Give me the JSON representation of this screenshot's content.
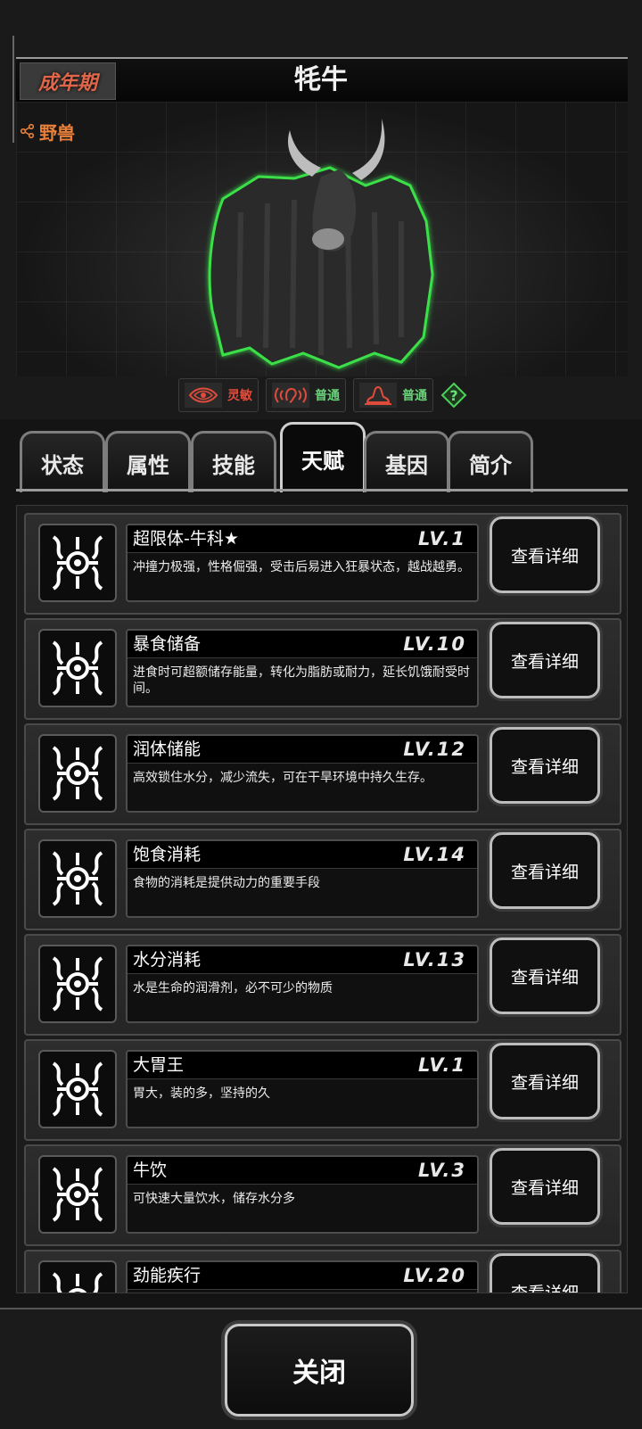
{
  "header": {
    "stage": "成年期",
    "name": "牦牛",
    "category": "野兽"
  },
  "traits": [
    {
      "icon": "eye-icon",
      "label": "灵敏",
      "color": "#e04c3c"
    },
    {
      "icon": "ear-icon",
      "label": "普通",
      "color": "#6ad27a"
    },
    {
      "icon": "smell-icon",
      "label": "普通",
      "color": "#6ad27a"
    }
  ],
  "help_icon": "question-diamond-icon",
  "tabs": [
    {
      "label": "状态",
      "active": false
    },
    {
      "label": "属性",
      "active": false
    },
    {
      "label": "技能",
      "active": false
    },
    {
      "label": "天赋",
      "active": true
    },
    {
      "label": "基因",
      "active": false
    },
    {
      "label": "简介",
      "active": false
    }
  ],
  "detail_label": "查看详细",
  "talents": [
    {
      "name": "超限体-牛科★",
      "level": "LV.1",
      "desc": "冲撞力极强，性格倔强，受击后易进入狂暴状态，越战越勇。"
    },
    {
      "name": "暴食储备",
      "level": "LV.10",
      "desc": "进食时可超额储存能量，转化为脂肪或耐力，延长饥饿耐受时间。"
    },
    {
      "name": "润体储能",
      "level": "LV.12",
      "desc": "高效锁住水分，减少流失，可在干旱环境中持久生存。"
    },
    {
      "name": "饱食消耗",
      "level": "LV.14",
      "desc": "食物的消耗是提供动力的重要手段"
    },
    {
      "name": "水分消耗",
      "level": "LV.13",
      "desc": "水是生命的润滑剂，必不可少的物质"
    },
    {
      "name": "大胃王",
      "level": "LV.1",
      "desc": "胃大，装的多，坚持的久"
    },
    {
      "name": "牛饮",
      "level": "LV.3",
      "desc": "可快速大量饮水，储存水分多"
    },
    {
      "name": "劲能疾行",
      "level": "LV.20",
      "desc": ""
    }
  ],
  "footer": {
    "close_label": "关闭"
  }
}
